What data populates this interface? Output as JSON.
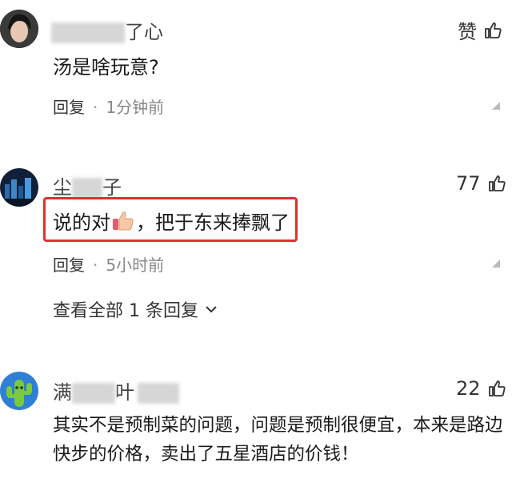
{
  "comments": [
    {
      "name_visible": "了心",
      "content": "汤是啥玩意?",
      "reply_label": "回复",
      "time": "1分钟前",
      "likes": "赞"
    },
    {
      "name_start": "尘",
      "name_end": "子",
      "content_before": "说的对",
      "content_after": "，把于东来捧飘了",
      "reply_label": "回复",
      "time": "5小时前",
      "likes": "77",
      "expand_label": "查看全部 1 条回复"
    },
    {
      "name_start": "满",
      "name_end": "叶",
      "content_line1": "其实不是预制菜的问题，问题是预制很便宜，本来是路边",
      "content_line2": "快步的价格，卖出了五星酒店的价钱！",
      "likes": "22"
    }
  ],
  "colors": {
    "highlight_box": "#e03030",
    "accent_icon": "#7ac943"
  }
}
